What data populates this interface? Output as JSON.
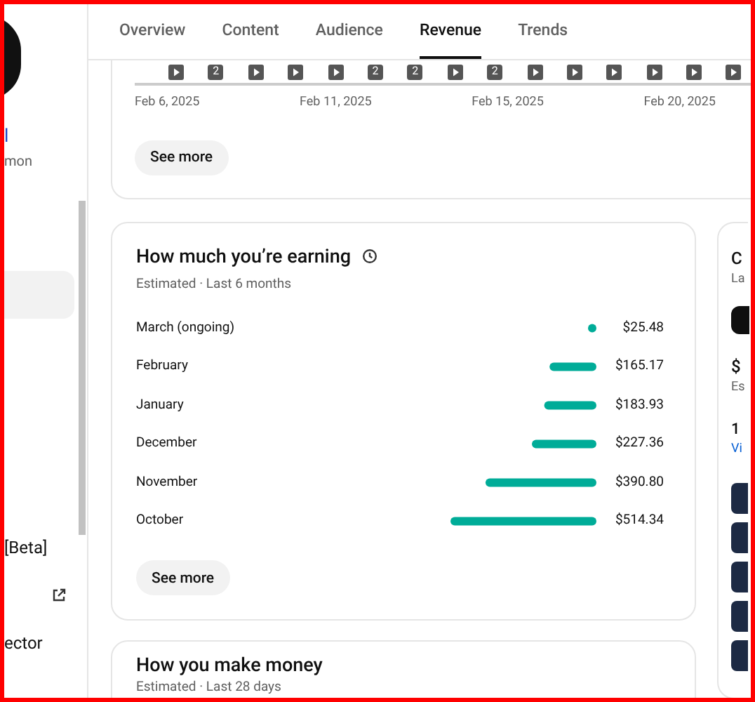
{
  "sidebar": {
    "channel_name": "l",
    "channel_subtitle": "mon",
    "items": [
      {
        "selected": true,
        "external": false
      },
      {
        "label": "[Beta]",
        "selected": false,
        "external": false
      },
      {
        "selected": false,
        "external": true
      },
      {
        "label": "ector",
        "selected": false,
        "external": false
      }
    ]
  },
  "tabs": [
    {
      "label": "Overview",
      "selected": false
    },
    {
      "label": "Content",
      "selected": false
    },
    {
      "label": "Audience",
      "selected": false
    },
    {
      "label": "Revenue",
      "selected": true
    },
    {
      "label": "Trends",
      "selected": false
    }
  ],
  "timeline": {
    "markers": [
      {
        "kind": "play"
      },
      {
        "kind": "count",
        "text": "2"
      },
      {
        "kind": "play"
      },
      {
        "kind": "play"
      },
      {
        "kind": "play"
      },
      {
        "kind": "count",
        "text": "2"
      },
      {
        "kind": "count",
        "text": "2"
      },
      {
        "kind": "play"
      },
      {
        "kind": "count",
        "text": "2"
      },
      {
        "kind": "play"
      },
      {
        "kind": "play"
      },
      {
        "kind": "play"
      },
      {
        "kind": "play"
      },
      {
        "kind": "play"
      },
      {
        "kind": "play"
      }
    ],
    "dates": [
      "Feb 6, 2025",
      "Feb 11, 2025",
      "Feb 15, 2025",
      "Feb 20, 2025"
    ],
    "button": "See more"
  },
  "earnings": {
    "title": "How much you’re earning",
    "subtitle": "Estimated · Last 6 months",
    "chart_data": {
      "type": "bar",
      "orientation": "horizontal",
      "categories": [
        "March (ongoing)",
        "February",
        "January",
        "December",
        "November",
        "October"
      ],
      "values": [
        25.48,
        165.17,
        183.93,
        227.36,
        390.8,
        514.34
      ],
      "value_labels": [
        "$25.48",
        "$165.17",
        "$183.93",
        "$227.36",
        "$390.80",
        "$514.34"
      ]
    },
    "button": "See more"
  },
  "side_card": {
    "title": "C",
    "subtitle": "La",
    "value": "$",
    "value_caption": "Es",
    "count": "1",
    "link": "Vi"
  },
  "money": {
    "title": "How you make money",
    "subtitle": "Estimated · Last 28 days"
  }
}
